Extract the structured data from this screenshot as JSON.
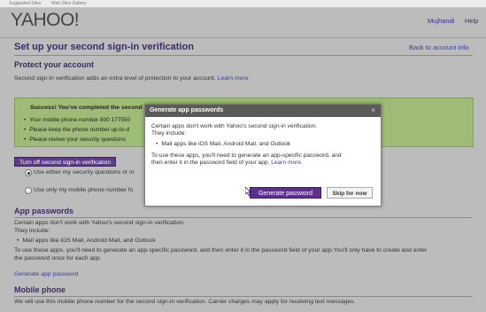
{
  "bookmarks": {
    "items": [
      "Suggested Sites",
      "Web Slice Gallery"
    ]
  },
  "header": {
    "logo": "YAHOO!",
    "user_name": "Mujhandi",
    "help": "Help",
    "page_title": "Set up your second sign-in verification",
    "back_link": "Back to account info"
  },
  "protect": {
    "heading": "Protect your account",
    "text": "Second sign-in verification adds an extra level of protection to your account.",
    "learn_more": "Learn more"
  },
  "success": {
    "title": "Success! You've completed the second sign-in verification setup.",
    "items": [
      "Your mobile phone number 800 177550",
      "Please keep the phone number up-to-d",
      "Please review your security questions"
    ]
  },
  "turn_off_button": "Turn off second sign-in verification",
  "options": {
    "option1": "Use either my security questions or m",
    "option2": "Use only my mobile phone number fo"
  },
  "app_passwords": {
    "heading": "App passwords",
    "line1": "Certain apps don't work with Yahoo's second sign-in verification.",
    "line2": "They include:",
    "bullet": "Mail apps like iOS Mail, Android Mail, and Outlook",
    "line3": "To use these apps, you'll need to generate an app-specific password, and then enter it in the password field of your app.You'll only have to create and enter",
    "line4": "the password once for each app.",
    "generate_link": "Generate app password"
  },
  "mobile_phone": {
    "heading": "Mobile phone",
    "text": "We will use this mobile phone number for the second sign-in verification. Carrier charges may apply for receiving text messages."
  },
  "modal": {
    "title": "Generate app passwords",
    "close": "×",
    "line1": "Certain apps don't work with Yahoo's second sign-in verification.",
    "line2": "They include:",
    "bullet": "Mail apps like iOS Mail, Android Mail, and Outlook",
    "line3": "To use these apps, you'll need to generate an app-specific password, and",
    "line4_prefix": "then enter it in the password field of your app.",
    "learn_more": "Learn more",
    "generate_button": "Generate password",
    "skip_button": "Skip for now"
  },
  "colors": {
    "accent_purple": "#5d2f8f",
    "heading_purple": "#3c2a66",
    "success_green": "#9ebb77",
    "link_blue": "#3b3b9e"
  }
}
